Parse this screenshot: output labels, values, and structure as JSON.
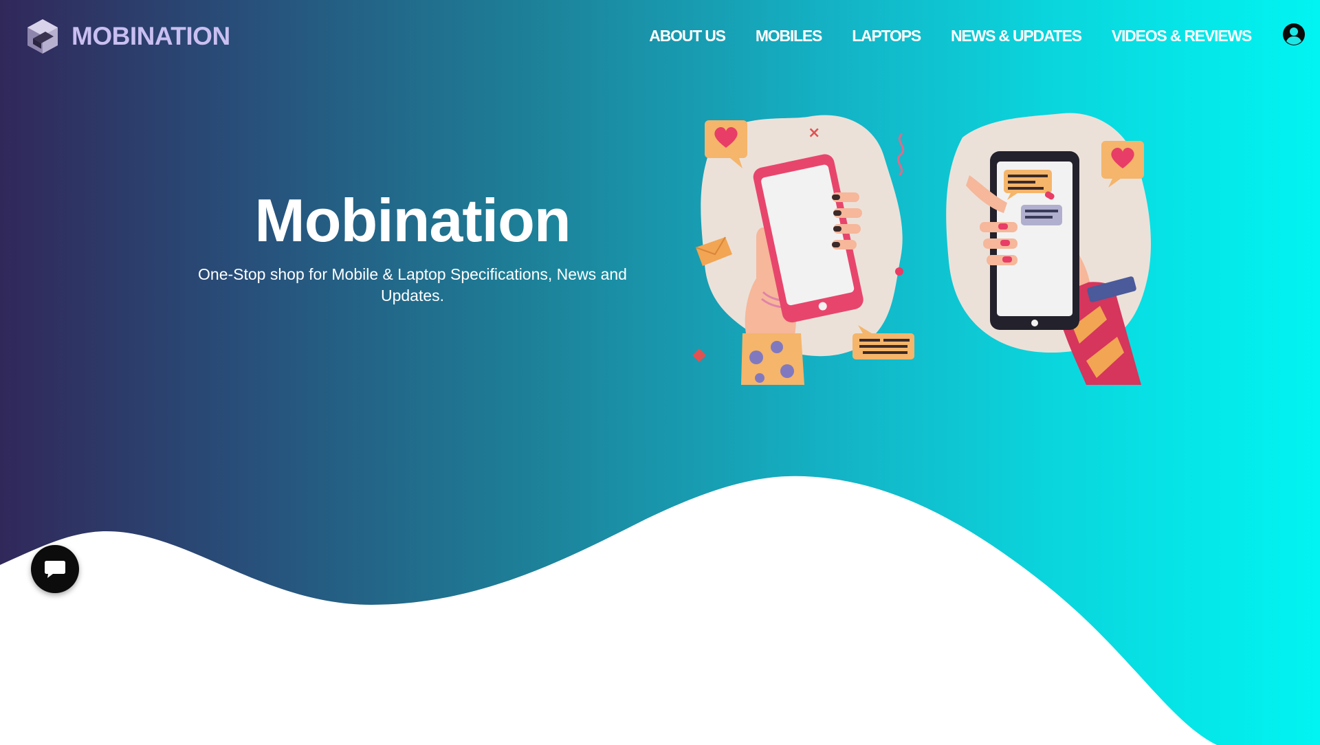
{
  "brand": {
    "name": "MOBINATION",
    "logo_icon": "cube-logo-icon"
  },
  "nav": {
    "items": [
      {
        "label": "ABOUT US"
      },
      {
        "label": "MOBILES"
      },
      {
        "label": "LAPTOPS"
      },
      {
        "label": "NEWS & UPDATES"
      },
      {
        "label": "VIDEOS & REVIEWS"
      }
    ],
    "account_icon": "user-circle-icon"
  },
  "hero": {
    "title": "Mobination",
    "subtitle": "One-Stop shop for Mobile & Laptop Specifications, News and Updates."
  },
  "chat": {
    "icon": "chat-bubble-icon"
  },
  "colors": {
    "gradient_start": "#31285a",
    "gradient_mid": "#1d8098",
    "gradient_end": "#01f4f2",
    "brand_text": "#c9bff0",
    "wave": "#ffffff"
  }
}
